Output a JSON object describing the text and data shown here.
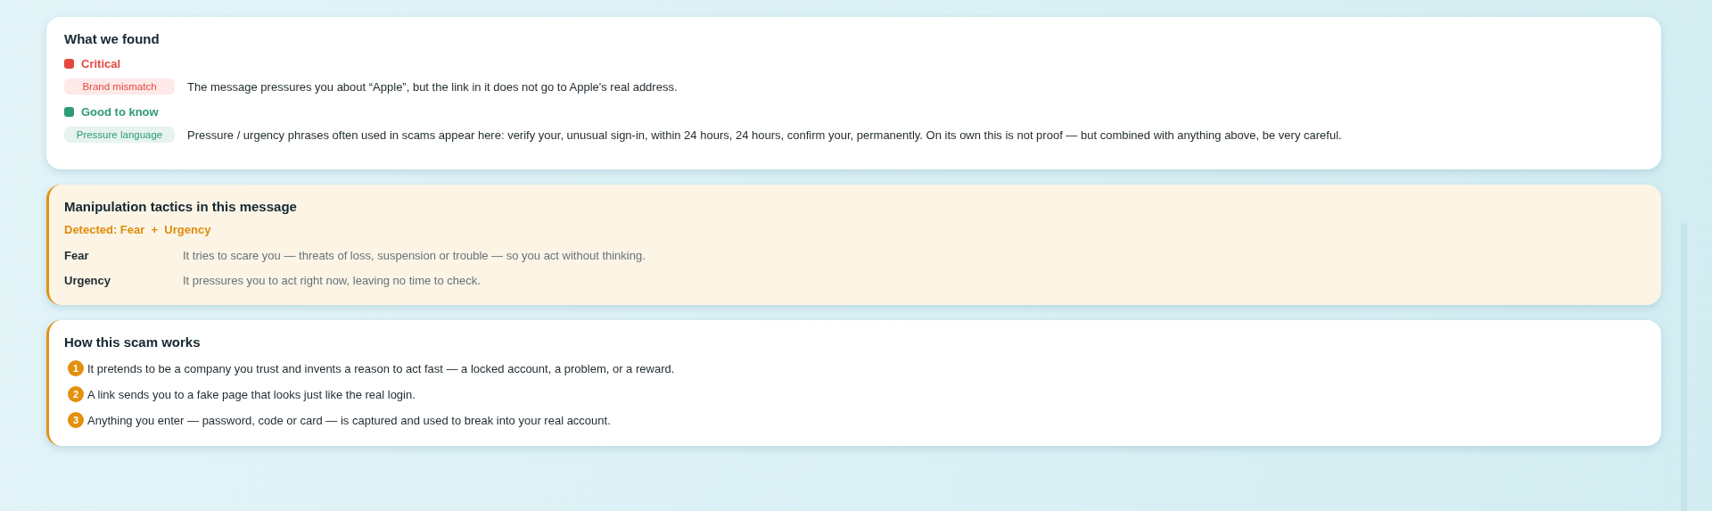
{
  "findings": {
    "title": "What we found",
    "groups": [
      {
        "label": "Critical",
        "color": "#e5483e",
        "items": [
          {
            "tag": "Brand mismatch",
            "text": "The message pressures you about “Apple”, but the link in it does not go to Apple's real address."
          }
        ]
      },
      {
        "label": "Good to know",
        "color": "#2e9a78",
        "items": [
          {
            "tag": "Pressure language",
            "text": "Pressure / urgency phrases often used in scams appear here: verify your, unusual sign-in, within 24 hours, 24 hours, confirm your, permanently. On its own this is not proof — but combined with anything above, be very careful."
          }
        ]
      }
    ]
  },
  "tactics": {
    "title": "Manipulation tactics in this message",
    "detected": "Detected: Fear  +  Urgency",
    "items": [
      {
        "name": "Fear",
        "text": "It tries to scare you — threats of loss, suspension or trouble — so you act without thinking."
      },
      {
        "name": "Urgency",
        "text": "It pressures you to act right now, leaving no time to check."
      }
    ]
  },
  "how": {
    "title": "How this scam works",
    "steps": [
      {
        "number": "1",
        "text": "It pretends to be a company you trust and invents a reason to act fast — a locked account, a problem, or a reward."
      },
      {
        "number": "2",
        "text": "A link sends you to a fake page that looks just like the real login."
      },
      {
        "number": "3",
        "text": "Anything you enter — password, code or card — is captured and used to break into your real account."
      }
    ]
  }
}
